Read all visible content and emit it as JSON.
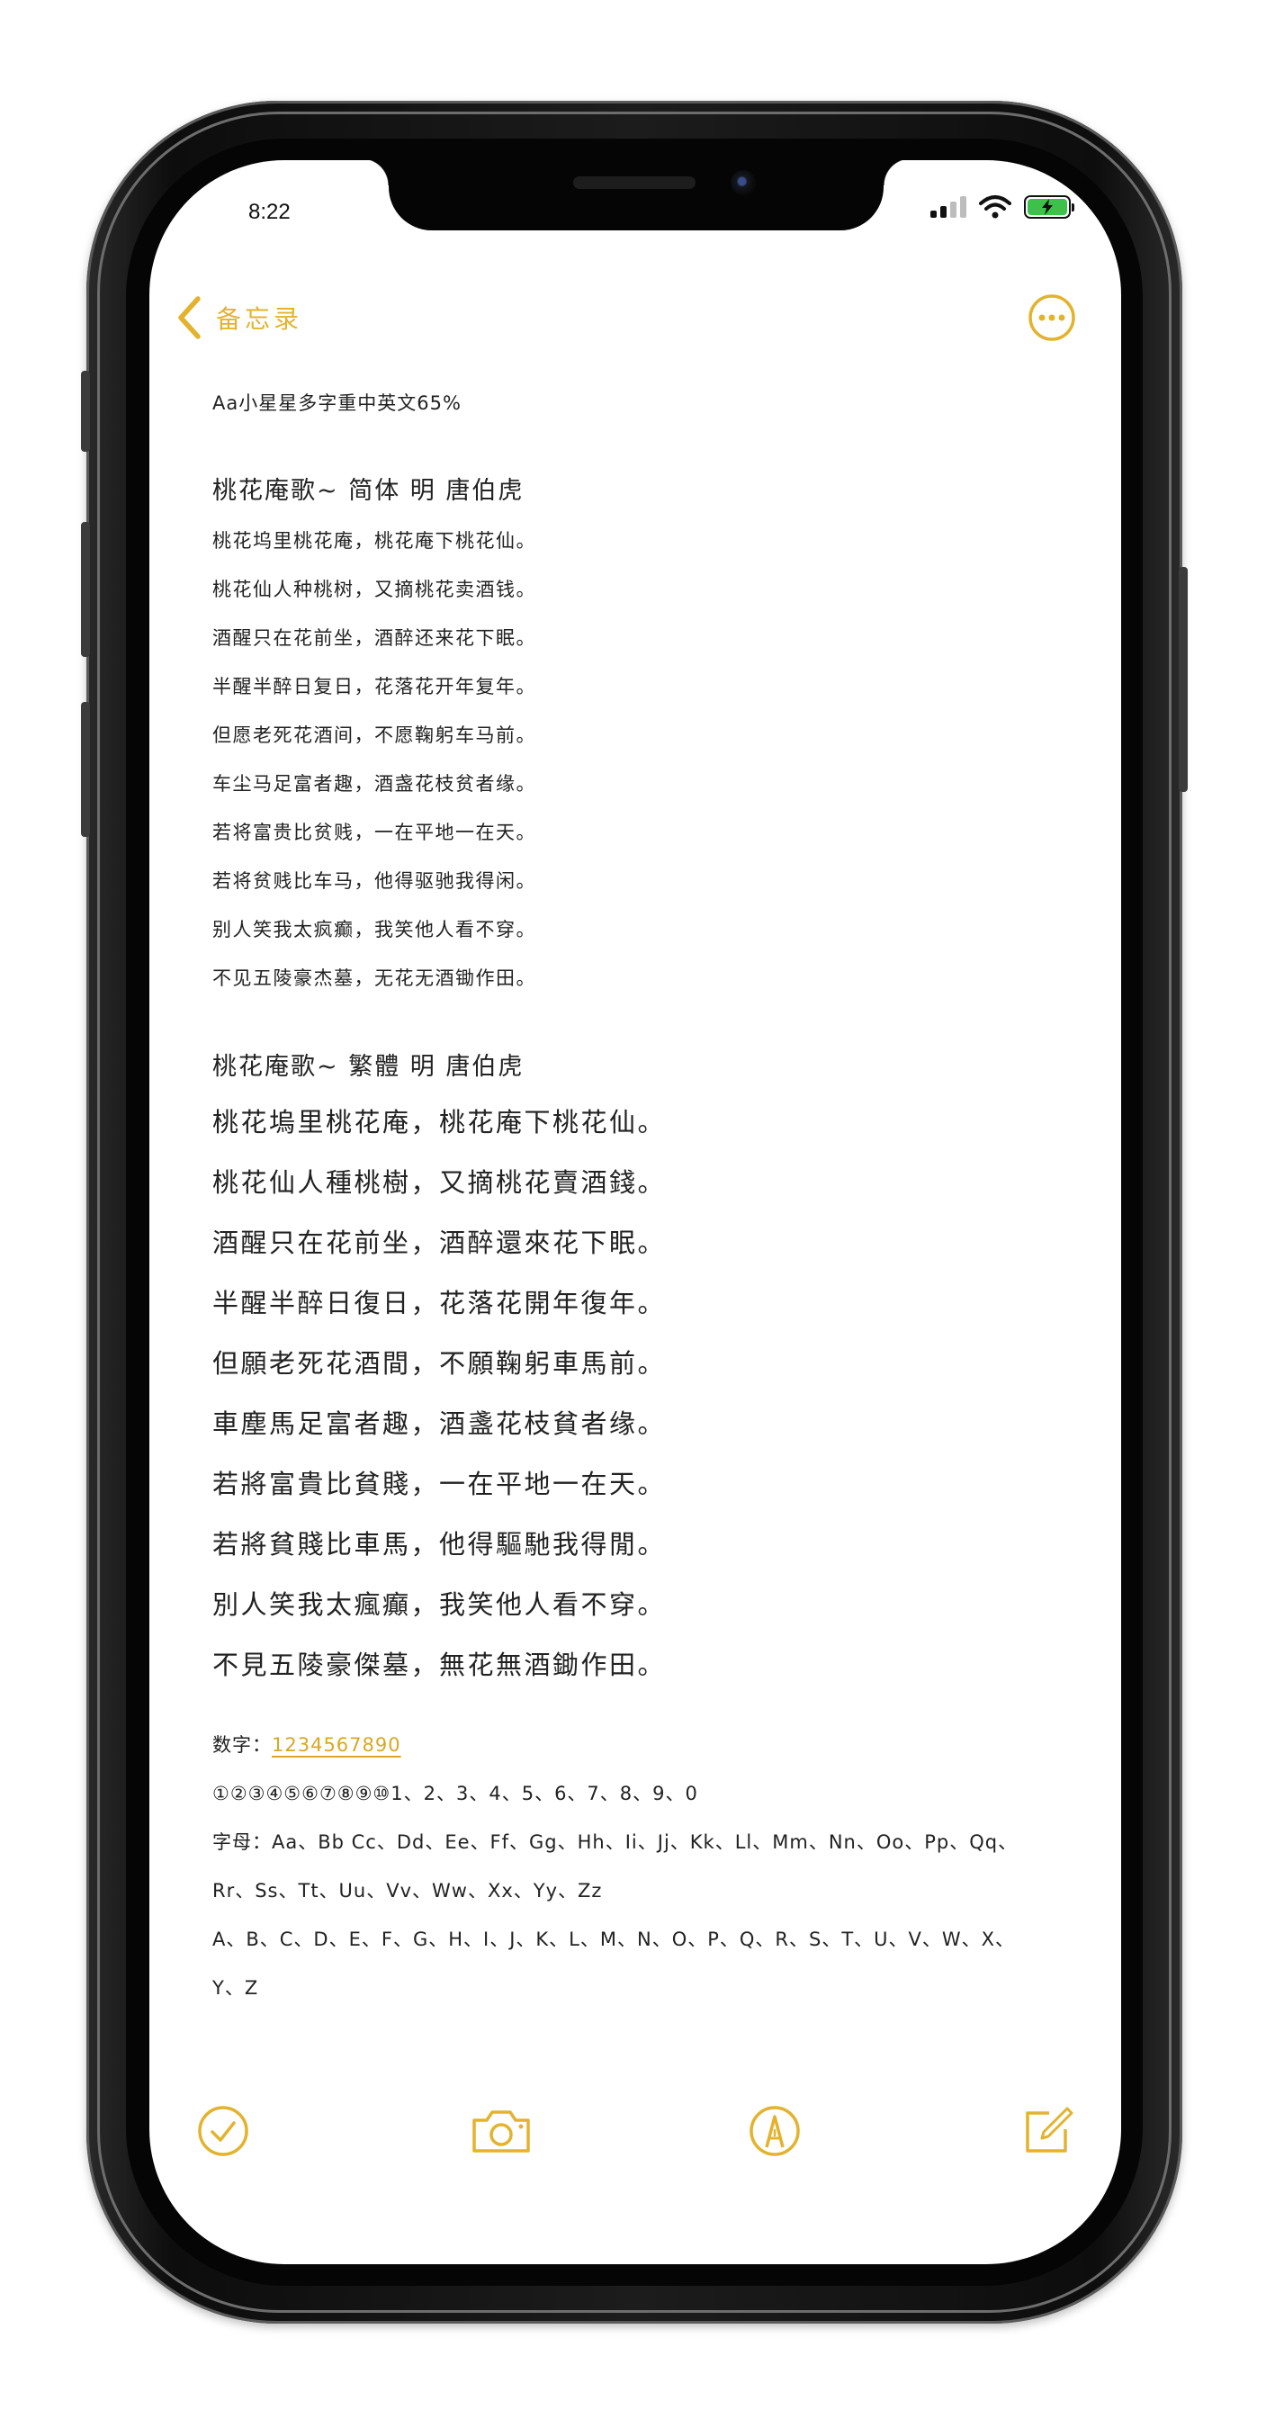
{
  "status_bar": {
    "time": "8:22"
  },
  "navbar": {
    "back_label": "备忘录"
  },
  "note": {
    "header": "Aa小星星多字重中英文65%",
    "simplified_title": "桃花庵歌~ 简体   明  唐伯虎",
    "simplified_lines": [
      "桃花坞里桃花庵，桃花庵下桃花仙。",
      "桃花仙人种桃树，又摘桃花卖酒钱。",
      "酒醒只在花前坐，酒醉还来花下眠。",
      "半醒半醉日复日，花落花开年复年。",
      "但愿老死花酒间，不愿鞠躬车马前。",
      "车尘马足富者趣，酒盏花枝贫者缘。",
      "若将富贵比贫贱，一在平地一在天。",
      "若将贫贱比车马，他得驱驰我得闲。",
      "别人笑我太疯癫，我笑他人看不穿。",
      "不见五陵豪杰墓，无花无酒锄作田。"
    ],
    "traditional_title": "桃花庵歌~ 繁體      明  唐伯虎",
    "traditional_lines": [
      "桃花塢里桃花庵，桃花庵下桃花仙。",
      "桃花仙人種桃樹，又摘桃花賣酒錢。",
      "酒醒只在花前坐，酒醉還來花下眠。",
      "半醒半醉日復日，花落花開年復年。",
      "但願老死花酒間，不願鞠躬車馬前。",
      "車塵馬足富者趣，酒盞花枝貧者缘。",
      "若將富貴比貧賤，一在平地一在天。",
      "若將貧賤比車馬，他得驅馳我得閒。",
      "別人笑我太瘋癲，我笑他人看不穿。",
      "不見五陵豪傑墓，無花無酒鋤作田。"
    ],
    "digits_label": "数字：",
    "digits_value": "1234567890",
    "circled_digits": "①②③④⑤⑥⑦⑧⑨⑩1、2、3、4、5、6、7、8、9、0",
    "letters_line1": "字母：Aa、Bb Cc、Dd、Ee、Ff、Gg、Hh、Ii、Jj、Kk、Ll、Mm、Nn、Oo、Pp、Qq、",
    "letters_line2": "Rr、Ss、Tt、Uu、Vv、Ww、Xx、Yy、Zz",
    "upper_line1": "A、B、C、D、E、F、G、H、I、J、K、L、M、N、O、P、Q、R、S、T、U、V、W、X、",
    "upper_line2": "Y、Z"
  },
  "icons": {
    "back": "chevron-left-icon",
    "more": "ellipsis-circle-icon",
    "checklist": "checkmark-circle-icon",
    "camera": "camera-icon",
    "markup": "pen-tip-circle-icon",
    "compose": "compose-icon"
  },
  "colors": {
    "accent": "#e3b32e",
    "text": "#222222",
    "battery": "#3cc24a"
  }
}
